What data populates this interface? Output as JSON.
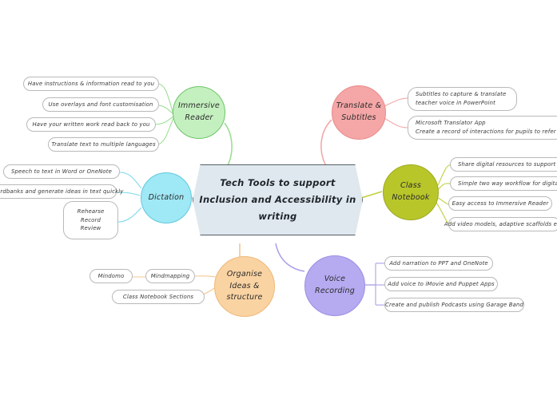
{
  "background": "#ffffff",
  "central": {
    "lines": [
      "Tech Tools to support",
      "Inclusion and Accessibility in",
      "writing"
    ],
    "fill": "#dfe8ef",
    "stroke": "#555f66"
  },
  "branches": [
    {
      "id": "immersive-reader",
      "lines": [
        "Immersive",
        "Reader"
      ],
      "fill": "#c4f0bf",
      "stroke": "#6fc46a",
      "children": [
        {
          "lines": [
            "Have instructions & information read to you"
          ]
        },
        {
          "lines": [
            "Use overlays and font customisation"
          ]
        },
        {
          "lines": [
            "Have your written work read back to you"
          ]
        },
        {
          "lines": [
            "Translate text to multiple languages"
          ]
        }
      ]
    },
    {
      "id": "translate-subtitles",
      "lines": [
        "Translate &",
        "Subtitles"
      ],
      "fill": "#f5a6a6",
      "stroke": "#e98a8a",
      "children": [
        {
          "lines": [
            "Subtitles to capture & translate",
            "teacher voice in PowerPoint"
          ]
        },
        {
          "lines": [
            "Microsoft Translator App",
            "Create a record of interactions for pupils to refer to"
          ]
        }
      ]
    },
    {
      "id": "dictation",
      "lines": [
        "Dictation"
      ],
      "fill": "#9fe8f5",
      "stroke": "#5fc9dd",
      "children": [
        {
          "lines": [
            "Speech to text in Word or OneNote"
          ]
        },
        {
          "lines": [
            "ordbanks and generate ideas in text quickly"
          ]
        },
        {
          "lines": [
            "Rehearse",
            "Record",
            "Review"
          ]
        }
      ]
    },
    {
      "id": "class-notebook",
      "lines": [
        "Class",
        "Notebook"
      ],
      "fill": "#b9c62a",
      "stroke": "#9daa1d",
      "children": [
        {
          "lines": [
            "Share digital resources to support writing"
          ]
        },
        {
          "lines": [
            "Simple two way workflow for digital feedback"
          ]
        },
        {
          "lines": [
            "Easy access to Immersive Reader"
          ]
        },
        {
          "lines": [
            "Add video models, adaptive scaffolds etc."
          ]
        }
      ]
    },
    {
      "id": "organise-ideas",
      "lines": [
        "Organise",
        "Ideas &",
        "structure"
      ],
      "fill": "#fad3a3",
      "stroke": "#eeb877",
      "children": [
        {
          "lines": [
            "Mindmapping"
          ]
        },
        {
          "lines": [
            "Class Notebook Sections"
          ]
        },
        {
          "lines": [
            "Mindomo"
          ]
        }
      ]
    },
    {
      "id": "voice-recording",
      "lines": [
        "Voice",
        "Recording"
      ],
      "fill": "#b6aaf0",
      "stroke": "#9c8ee4",
      "children": [
        {
          "lines": [
            "Add narration to PPT and OneNote"
          ]
        },
        {
          "lines": [
            "Add voice to iMovie and Puppet Apps"
          ]
        },
        {
          "lines": [
            "Create and publish Podcasts using Garage Band"
          ]
        }
      ]
    }
  ]
}
